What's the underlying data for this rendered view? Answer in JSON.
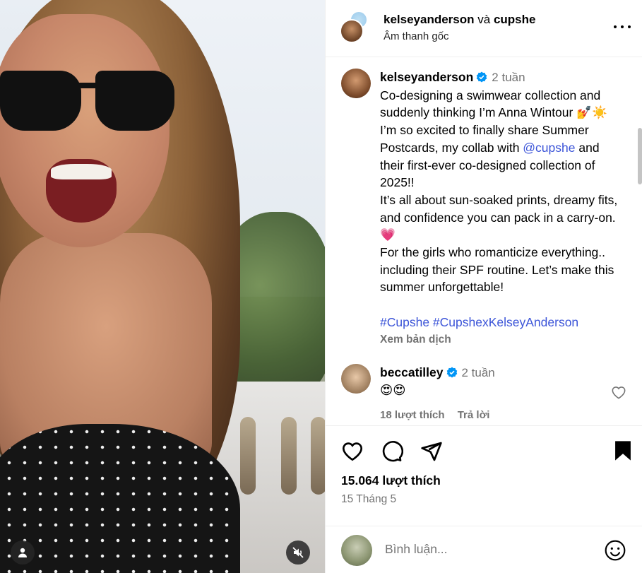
{
  "header": {
    "user1": "kelseyanderson",
    "conj": "và",
    "user2": "cupshe",
    "audio": "Âm thanh gốc"
  },
  "caption": {
    "username": "kelseyanderson",
    "time": "2 tuần",
    "text1": "Co-designing a swimwear collection and suddenly thinking I’m Anna Wintour 💅☀️ I’m so excited to finally share Summer Postcards, my collab with ",
    "mention": "@cupshe",
    "text2": " and their first-ever co-designed collection of 2025!!",
    "text3": "It’s all about sun-soaked prints, dreamy fits, and confidence you can pack in a carry-on. 💗",
    "text4": "For the girls who romanticize everything.. including their SPF routine. Let’s make this summer unforgettable!",
    "hashtags": "#Cupshe #CupshexKelseyAnderson",
    "translate": "Xem bản dịch"
  },
  "comment": {
    "username": "beccatilley",
    "time": "2 tuần",
    "text": "😍😍",
    "likes": "18 lượt thích",
    "reply": "Trả lời"
  },
  "post": {
    "likes": "15.064 lượt thích",
    "date": "15 Tháng 5"
  },
  "composer": {
    "placeholder": "Bình luận..."
  },
  "icons": [
    "heart-icon",
    "comment-icon",
    "share-icon",
    "bookmark-icon",
    "more-icon",
    "user-tag-icon",
    "mute-icon",
    "emoji-icon",
    "verified-icon"
  ],
  "colors": {
    "accent_link": "#3b54d8",
    "verified": "#0095f6",
    "muted_text": "#737373"
  }
}
